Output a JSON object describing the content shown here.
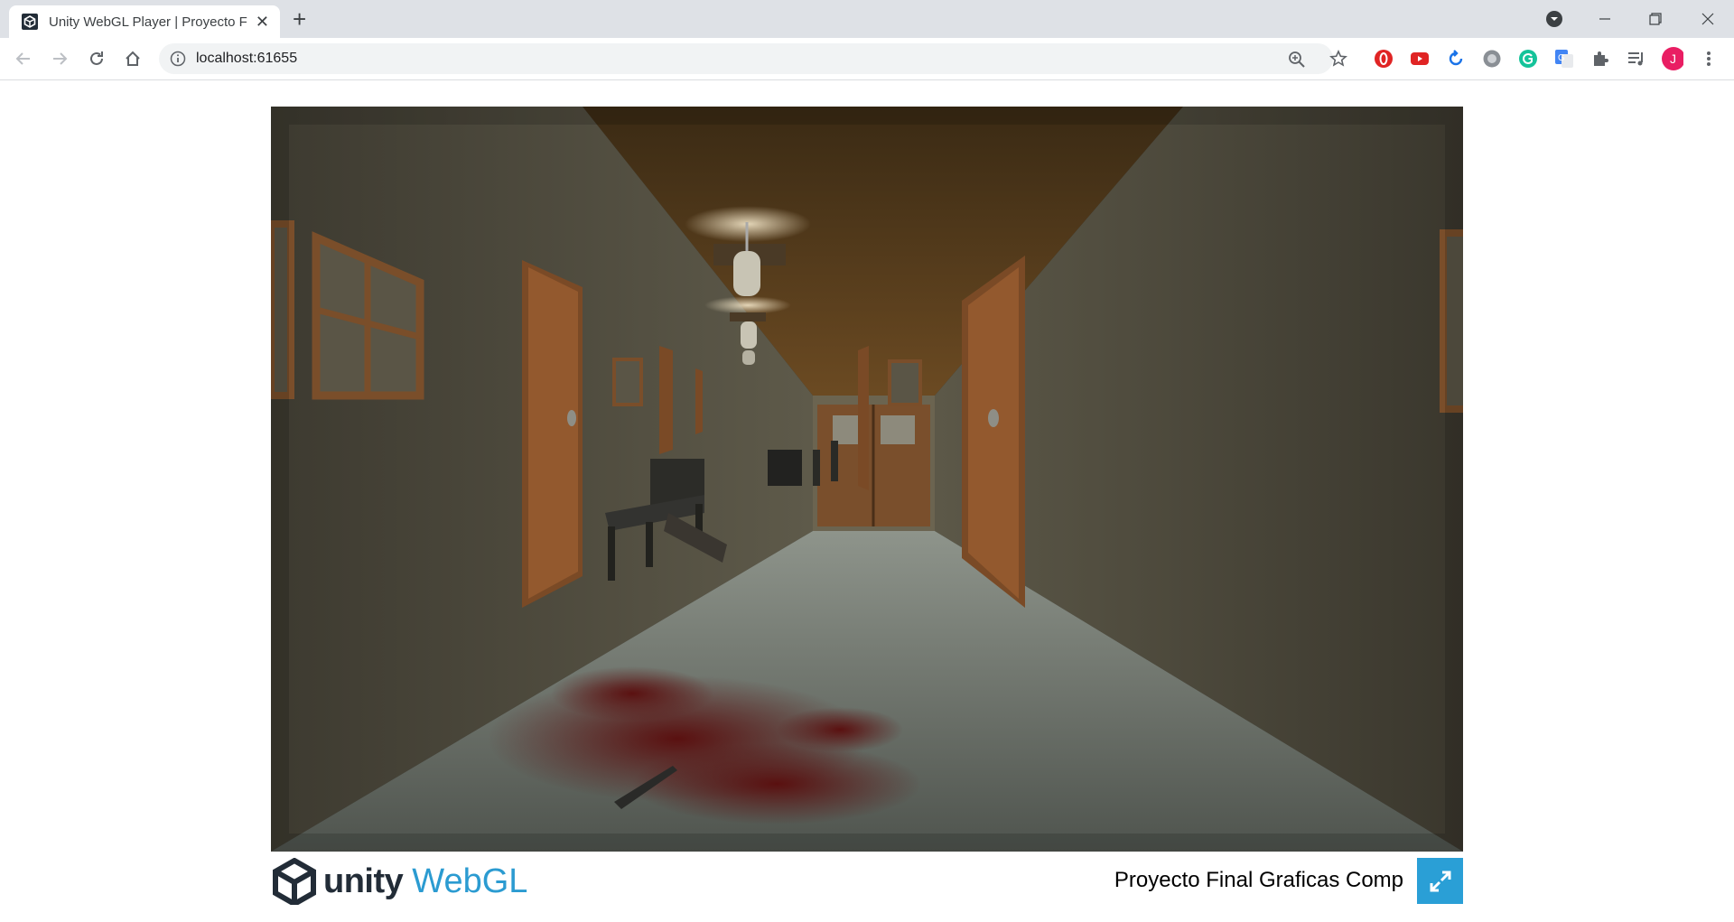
{
  "browser": {
    "tab_title": "Unity WebGL Player | Proyecto Final Graficas Comp",
    "new_tab_label": "+",
    "url": "localhost:61655",
    "profile_initial": "J",
    "accent_profile": "#e91e63"
  },
  "game": {
    "scene": "dark hallway with doors, ceiling lamps, chair, bench, blood stain and knife"
  },
  "footer": {
    "logo_unity": "unity",
    "logo_webgl": "WebGL",
    "project_title": "Proyecto Final Graficas Comp",
    "fullscreen_icon": "fullscreen-icon",
    "accent": "#2a9fd6"
  }
}
